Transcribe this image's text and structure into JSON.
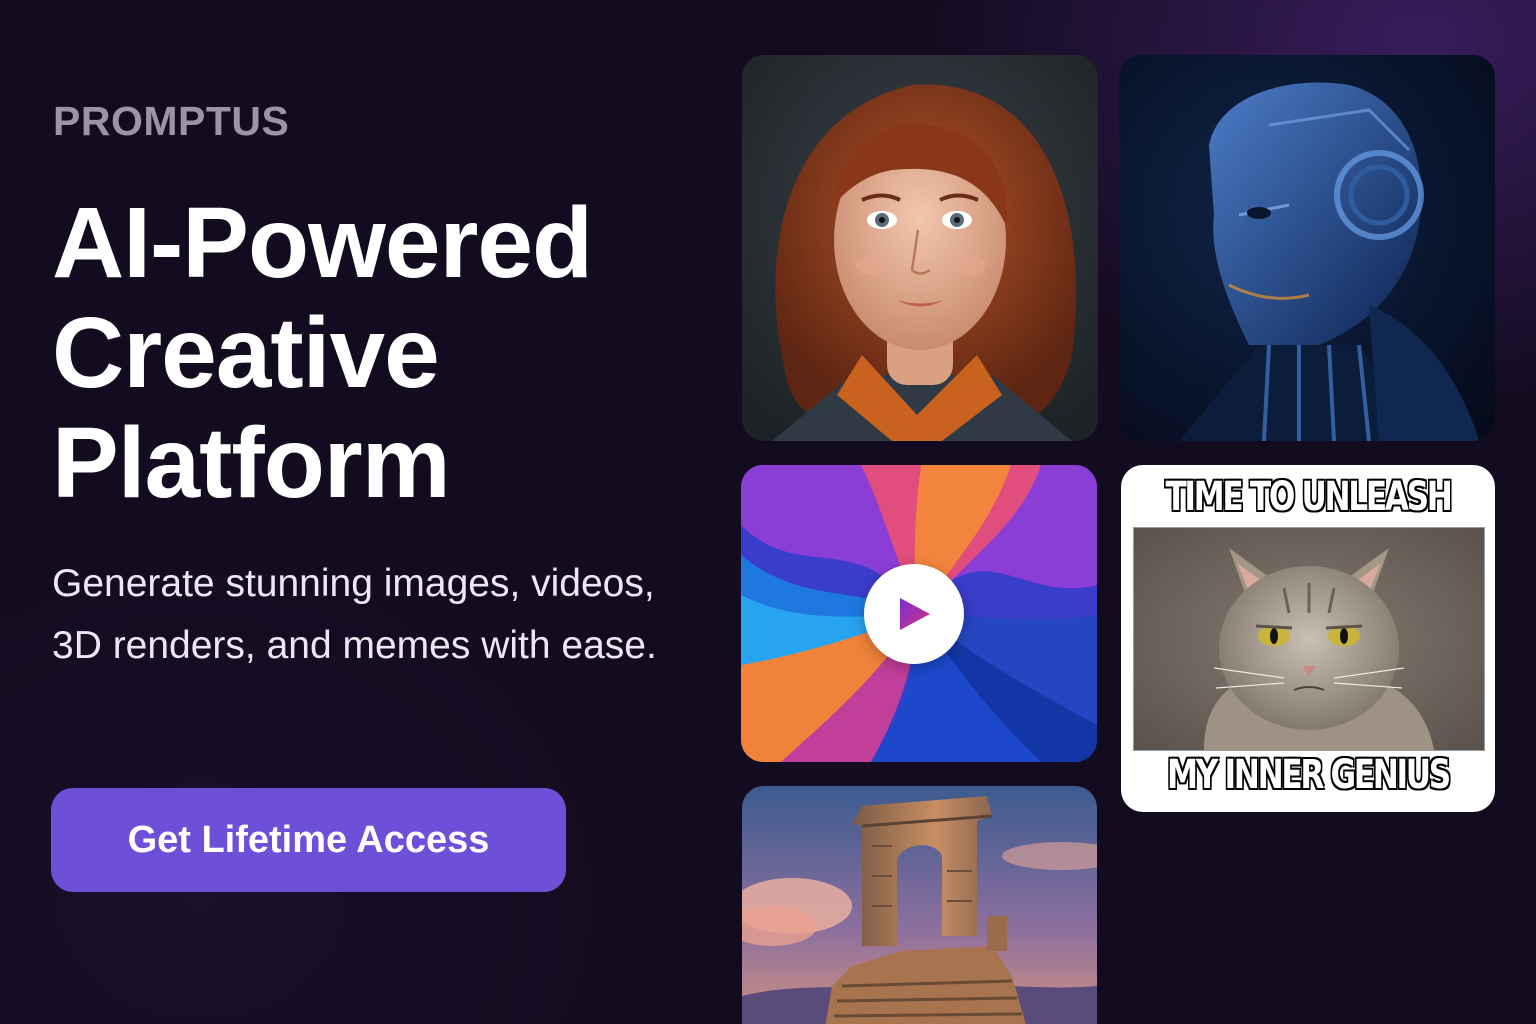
{
  "brand": {
    "name": "PROMPTUS"
  },
  "hero": {
    "headline_lines": [
      "AI-Powered",
      "Creative",
      "Platform"
    ],
    "subtitle": "Generate stunning images, videos, 3D renders, and memes with ease.",
    "cta_label": "Get Lifetime Access"
  },
  "gallery": {
    "tiles": [
      {
        "kind": "image",
        "subject": "portrait of red-haired woman"
      },
      {
        "kind": "image",
        "subject": "blue humanoid robot"
      },
      {
        "kind": "video",
        "subject": "colorful abstract waves",
        "icon": "play-icon"
      },
      {
        "kind": "meme",
        "top_text": "TIME TO UNLEASH",
        "bottom_text": "MY INNER GENIUS",
        "subject": "grumpy cat"
      },
      {
        "kind": "3d-render",
        "subject": "stone arch ruins at sunset"
      }
    ]
  },
  "colors": {
    "background": "#130c20",
    "accent": "#6e4fd8",
    "brand_text": "#9b93a6"
  }
}
